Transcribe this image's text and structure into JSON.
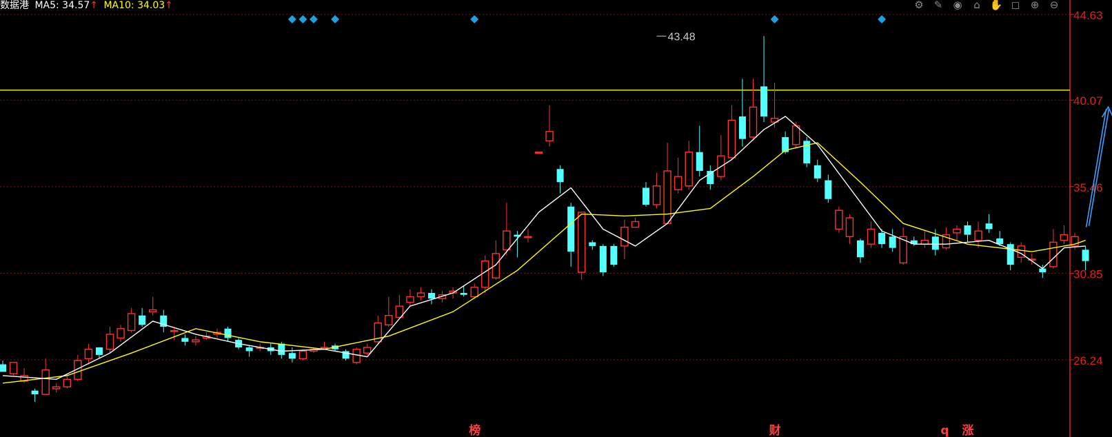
{
  "header": {
    "name_fragment": "数据港",
    "ma5_label": "MA5: 34.57",
    "ma5_arrow": "↑",
    "ma10_label": "MA10: 34.03",
    "ma10_arrow": "↑"
  },
  "toolbar": {
    "icons": [
      {
        "name": "settings-icon",
        "glyph": "⚙"
      },
      {
        "name": "draw-pen-icon",
        "glyph": "✎"
      },
      {
        "name": "eye-icon",
        "glyph": "◉"
      },
      {
        "name": "store-icon",
        "glyph": "⌂"
      },
      {
        "name": "hand-icon",
        "glyph": "✋"
      },
      {
        "name": "window-icon",
        "glyph": "◻"
      },
      {
        "name": "zoom-in-icon",
        "glyph": "⊕"
      },
      {
        "name": "zoom-out-icon",
        "glyph": "⊖"
      }
    ]
  },
  "colors": {
    "background": "#000000",
    "up": "#ff3232",
    "down": "#54ffff",
    "ma5": "#ffffff",
    "ma10": "#ffff00",
    "level_line": "#e5e500",
    "price_axis": "#e02020",
    "grid": "#7a1a1a",
    "marker": "#1fa0e0",
    "arrow": "#3aa0ff",
    "high_label": "#c8c8c8",
    "event_label": "#ff4040"
  },
  "chart_data": {
    "type": "candlestick",
    "y_ticks": [
      "44.63",
      "40.07",
      "35.46",
      "30.85",
      "26.24"
    ],
    "ylim": [
      21.42,
      45.77
    ],
    "grid": "dotted horizontal",
    "x_count": 102,
    "high_annotation": {
      "index": 61,
      "value": "43.48"
    },
    "candles": [
      [
        0,
        26.0,
        25.6,
        26.2,
        25.6
      ],
      [
        1,
        25.5,
        26.1,
        26.1,
        25.4
      ],
      [
        2,
        25.1,
        25.4,
        25.8,
        25.0
      ],
      [
        3,
        24.6,
        24.4,
        24.7,
        24.0
      ],
      [
        4,
        24.4,
        25.7,
        26.3,
        24.4
      ],
      [
        5,
        24.7,
        24.8,
        25.0,
        24.5
      ],
      [
        6,
        24.8,
        25.2,
        25.5,
        24.7
      ],
      [
        7,
        25.2,
        26.2,
        26.5,
        25.1
      ],
      [
        8,
        26.3,
        26.8,
        27.1,
        26.0
      ],
      [
        9,
        26.9,
        26.5,
        26.9,
        26.3
      ],
      [
        10,
        26.8,
        27.6,
        28.0,
        26.6
      ],
      [
        11,
        27.4,
        27.9,
        28.1,
        27.2
      ],
      [
        12,
        27.8,
        28.7,
        29.0,
        27.7
      ],
      [
        13,
        28.6,
        28.1,
        29.0,
        28.0
      ],
      [
        14,
        28.8,
        28.9,
        29.6,
        28.6
      ],
      [
        15,
        28.6,
        28.0,
        28.9,
        27.7
      ],
      [
        16,
        27.8,
        27.8,
        28.0,
        27.3
      ],
      [
        17,
        27.4,
        27.2,
        27.6,
        27.0
      ],
      [
        18,
        27.2,
        27.3,
        27.5,
        27.0
      ],
      [
        19,
        27.4,
        27.5,
        27.7,
        27.3
      ],
      [
        20,
        27.6,
        27.7,
        27.9,
        27.4
      ],
      [
        21,
        27.9,
        27.4,
        28.0,
        27.2
      ],
      [
        22,
        27.3,
        26.9,
        27.4,
        26.8
      ],
      [
        23,
        26.9,
        26.7,
        27.0,
        26.4
      ],
      [
        24,
        26.9,
        26.9,
        27.1,
        26.7
      ],
      [
        25,
        26.9,
        26.7,
        27.1,
        26.5
      ],
      [
        26,
        27.1,
        26.5,
        27.2,
        26.3
      ],
      [
        27,
        26.6,
        26.3,
        26.9,
        26.1
      ],
      [
        28,
        26.3,
        26.7,
        26.8,
        26.2
      ],
      [
        29,
        26.7,
        26.8,
        26.9,
        26.6
      ],
      [
        30,
        26.9,
        26.9,
        27.2,
        26.8
      ],
      [
        31,
        27.0,
        26.8,
        27.1,
        26.7
      ],
      [
        32,
        26.7,
        26.3,
        26.8,
        26.2
      ],
      [
        33,
        26.1,
        26.8,
        26.9,
        26.0
      ],
      [
        34,
        26.6,
        26.9,
        27.1,
        26.5
      ],
      [
        35,
        27.2,
        28.2,
        28.6,
        27.1
      ],
      [
        36,
        28.1,
        28.6,
        29.6,
        28.0
      ],
      [
        37,
        28.5,
        29.1,
        29.7,
        28.4
      ],
      [
        38,
        29.3,
        29.6,
        30.0,
        29.1
      ],
      [
        39,
        29.6,
        29.8,
        30.1,
        29.4
      ],
      [
        40,
        29.8,
        29.5,
        30.0,
        29.2
      ],
      [
        41,
        29.5,
        29.7,
        29.9,
        29.3
      ],
      [
        42,
        29.8,
        29.9,
        30.1,
        29.5
      ],
      [
        43,
        29.8,
        29.7,
        30.2,
        29.6
      ],
      [
        44,
        29.6,
        30.1,
        30.3,
        29.5
      ],
      [
        45,
        30.1,
        31.5,
        31.8,
        29.8
      ],
      [
        46,
        30.6,
        31.9,
        32.6,
        30.5
      ],
      [
        47,
        32.1,
        33.1,
        34.6,
        31.8
      ],
      [
        48,
        32.9,
        32.8,
        33.1,
        31.7
      ],
      [
        49,
        32.8,
        32.8,
        33.2,
        32.5
      ],
      [
        50,
        37.3,
        37.3,
        37.3,
        37.3
      ],
      [
        51,
        37.9,
        38.4,
        39.8,
        37.6
      ],
      [
        52,
        36.4,
        35.7,
        36.6,
        35.1
      ],
      [
        53,
        34.4,
        32.0,
        34.6,
        31.2
      ],
      [
        54,
        30.9,
        34.1,
        34.1,
        30.5
      ],
      [
        55,
        32.5,
        32.3,
        32.6,
        32.1
      ],
      [
        56,
        32.3,
        30.9,
        32.4,
        30.7
      ],
      [
        57,
        32.3,
        31.3,
        32.4,
        31.2
      ],
      [
        58,
        32.3,
        33.3,
        33.7,
        31.6
      ],
      [
        59,
        33.3,
        33.6,
        33.8,
        33.4
      ],
      [
        60,
        35.4,
        34.5,
        35.7,
        34.4
      ],
      [
        61,
        34.5,
        35.5,
        36.2,
        34.3
      ],
      [
        62,
        33.5,
        36.3,
        37.8,
        33.5
      ],
      [
        63,
        35.3,
        36.0,
        37.0,
        35.1
      ],
      [
        64,
        35.5,
        37.3,
        37.9,
        35.3
      ],
      [
        65,
        37.3,
        36.3,
        38.7,
        36.0
      ],
      [
        66,
        36.3,
        35.6,
        36.6,
        35.3
      ],
      [
        67,
        36.0,
        37.1,
        38.2,
        35.8
      ],
      [
        68,
        37.0,
        39.0,
        39.8,
        36.9
      ],
      [
        69,
        39.2,
        38.0,
        41.2,
        37.6
      ],
      [
        70,
        38.1,
        39.7,
        41.2,
        37.9
      ],
      [
        71,
        40.8,
        39.2,
        43.48,
        38.9
      ],
      [
        72,
        38.9,
        39.1,
        41.0,
        38.6
      ],
      [
        73,
        38.1,
        37.3,
        38.4,
        37.2
      ],
      [
        74,
        37.7,
        38.7,
        38.9,
        37.5
      ],
      [
        75,
        37.9,
        36.7,
        38.1,
        36.5
      ],
      [
        76,
        36.6,
        35.9,
        36.9,
        35.7
      ],
      [
        77,
        35.8,
        34.8,
        36.1,
        34.6
      ],
      [
        78,
        33.2,
        34.2,
        34.4,
        33.0
      ],
      [
        79,
        32.8,
        33.8,
        34.0,
        32.4
      ],
      [
        80,
        32.6,
        31.7,
        32.7,
        31.4
      ],
      [
        81,
        32.4,
        33.2,
        33.6,
        32.2
      ],
      [
        82,
        33.0,
        32.4,
        33.2,
        32.2
      ],
      [
        83,
        32.8,
        32.2,
        33.2,
        32.0
      ],
      [
        84,
        31.4,
        32.8,
        33.3,
        31.3
      ],
      [
        85,
        32.6,
        32.4,
        32.8,
        32.3
      ],
      [
        86,
        32.4,
        32.6,
        33.1,
        32.2
      ],
      [
        87,
        32.8,
        32.1,
        33.2,
        31.8
      ],
      [
        88,
        32.2,
        32.9,
        33.3,
        32.1
      ],
      [
        89,
        33.0,
        33.2,
        33.4,
        32.6
      ],
      [
        90,
        33.4,
        32.9,
        33.6,
        32.5
      ],
      [
        91,
        32.6,
        33.1,
        33.6,
        32.2
      ],
      [
        92,
        33.5,
        33.2,
        34.0,
        33.0
      ],
      [
        93,
        32.7,
        32.4,
        33.1,
        32.3
      ],
      [
        94,
        32.4,
        31.3,
        32.5,
        31.0
      ],
      [
        95,
        31.7,
        32.3,
        32.5,
        31.4
      ],
      [
        96,
        31.6,
        31.6,
        31.9,
        31.3
      ],
      [
        97,
        31.1,
        30.9,
        31.3,
        30.6
      ],
      [
        98,
        31.2,
        32.5,
        33.2,
        31.1
      ],
      [
        99,
        32.6,
        32.9,
        33.4,
        32.4
      ],
      [
        100,
        32.3,
        32.8,
        33.0,
        32.1
      ],
      [
        101,
        32.1,
        31.5,
        32.3,
        31.0
      ]
    ],
    "ma5": [
      [
        0,
        25.4
      ],
      [
        5,
        25.2
      ],
      [
        10,
        26.6
      ],
      [
        14,
        28.3
      ],
      [
        18,
        27.6
      ],
      [
        22,
        27.1
      ],
      [
        26,
        26.7
      ],
      [
        30,
        26.8
      ],
      [
        34,
        26.4
      ],
      [
        38,
        29.1
      ],
      [
        42,
        29.8
      ],
      [
        46,
        31.3
      ],
      [
        50,
        34.1
      ],
      [
        53,
        35.4
      ],
      [
        56,
        33.2
      ],
      [
        59,
        32.3
      ],
      [
        62,
        33.5
      ],
      [
        65,
        35.8
      ],
      [
        68,
        36.9
      ],
      [
        71,
        38.5
      ],
      [
        73,
        39.2
      ],
      [
        76,
        37.7
      ],
      [
        79,
        35.4
      ],
      [
        82,
        33.1
      ],
      [
        85,
        32.4
      ],
      [
        88,
        32.4
      ],
      [
        92,
        32.6
      ],
      [
        95,
        31.9
      ],
      [
        97,
        31.1
      ],
      [
        99,
        32.2
      ],
      [
        101,
        32.3
      ]
    ],
    "ma10": [
      [
        0,
        25.0
      ],
      [
        6,
        25.4
      ],
      [
        12,
        26.6
      ],
      [
        18,
        27.9
      ],
      [
        24,
        27.2
      ],
      [
        30,
        26.8
      ],
      [
        36,
        27.5
      ],
      [
        42,
        28.8
      ],
      [
        48,
        31.0
      ],
      [
        54,
        34.0
      ],
      [
        58,
        33.9
      ],
      [
        62,
        34.0
      ],
      [
        66,
        34.3
      ],
      [
        70,
        36.0
      ],
      [
        73,
        37.4
      ],
      [
        76,
        37.8
      ],
      [
        80,
        35.7
      ],
      [
        84,
        33.5
      ],
      [
        90,
        32.4
      ],
      [
        96,
        32.0
      ],
      [
        100,
        32.4
      ],
      [
        101,
        32.6
      ]
    ],
    "level_line": 40.6,
    "markers_top": [
      27,
      28,
      29,
      31,
      44,
      72,
      82
    ],
    "event_labels": [
      {
        "index": 44,
        "text": "榜"
      },
      {
        "index": 72,
        "text": "财"
      },
      {
        "index": 88,
        "text": "q"
      },
      {
        "index": 90,
        "text": "涨"
      }
    ]
  }
}
